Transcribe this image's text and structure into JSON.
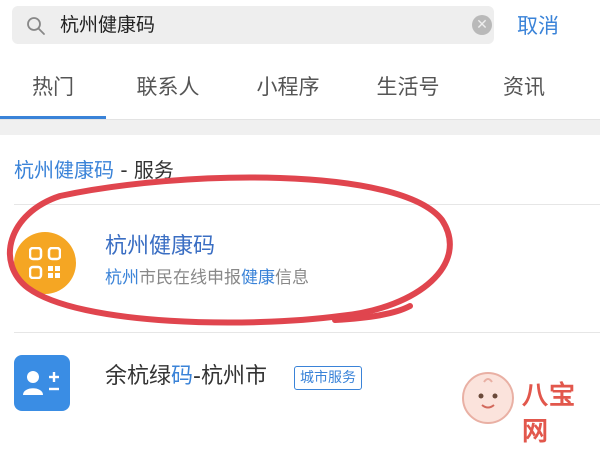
{
  "search": {
    "query": "杭州健康码",
    "cancel_label": "取消"
  },
  "tabs": [
    {
      "label": "热门",
      "active": true
    },
    {
      "label": "联系人",
      "active": false
    },
    {
      "label": "小程序",
      "active": false
    },
    {
      "label": "生活号",
      "active": false
    },
    {
      "label": "资讯",
      "active": false
    }
  ],
  "section": {
    "keyword": "杭州健康码",
    "suffix": " - 服务"
  },
  "results": [
    {
      "title": "杭州健康码",
      "desc_parts": [
        "杭州",
        "市民在线申报",
        "健康",
        "信息"
      ],
      "icon": "qr-code-icon"
    },
    {
      "title_parts": [
        "余杭绿",
        "码",
        "-杭州市"
      ],
      "badge": "城市服务",
      "icon": "contact-card-icon"
    }
  ],
  "watermark": {
    "text": "八宝网"
  },
  "colors": {
    "accent": "#3a83d8",
    "logo_orange": "#f5a623",
    "annotation_red": "#e0454e"
  }
}
